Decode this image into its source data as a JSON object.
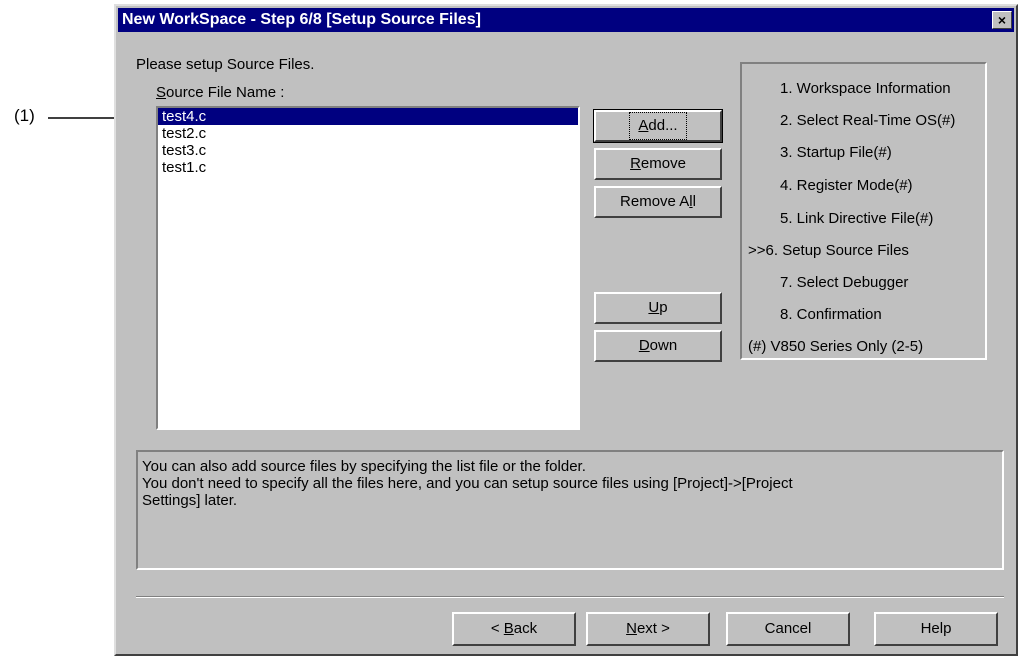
{
  "annotation": {
    "label": "(1)"
  },
  "window": {
    "title": "New WorkSpace - Step 6/8 [Setup Source Files]",
    "close_glyph": "×"
  },
  "prompt": "Please setup Source Files.",
  "list_label": {
    "accel": "S",
    "rest": "ource File Name :"
  },
  "files": [
    "test4.c",
    "test2.c",
    "test3.c",
    "test1.c"
  ],
  "buttons": {
    "add": {
      "accel": "A",
      "rest": "dd..."
    },
    "remove": {
      "accel": "R",
      "rest": "emove"
    },
    "remove_all": {
      "pre": "Remove A",
      "accel": "l",
      "rest": "l"
    },
    "up": {
      "accel": "U",
      "rest": "p"
    },
    "down": {
      "accel": "D",
      "rest": "own"
    }
  },
  "steps": [
    "1. Workspace Information",
    "2. Select Real-Time OS(#)",
    "3. Startup File(#)",
    "4. Register Mode(#)",
    "5. Link Directive File(#)",
    ">>6. Setup Source Files",
    "7. Select Debugger",
    "8. Confirmation",
    "(#) V850 Series Only (2-5)"
  ],
  "info_lines": [
    "You can also add source files by specifying the list file or the folder.",
    "You don't need to specify all the files here, and you can setup source files using [Project]->[Project",
    "Settings] later."
  ],
  "footer": {
    "back": {
      "pre": "< ",
      "accel": "B",
      "rest": "ack"
    },
    "next": {
      "accel": "N",
      "rest": "ext >"
    },
    "cancel": "Cancel",
    "help": "Help"
  }
}
